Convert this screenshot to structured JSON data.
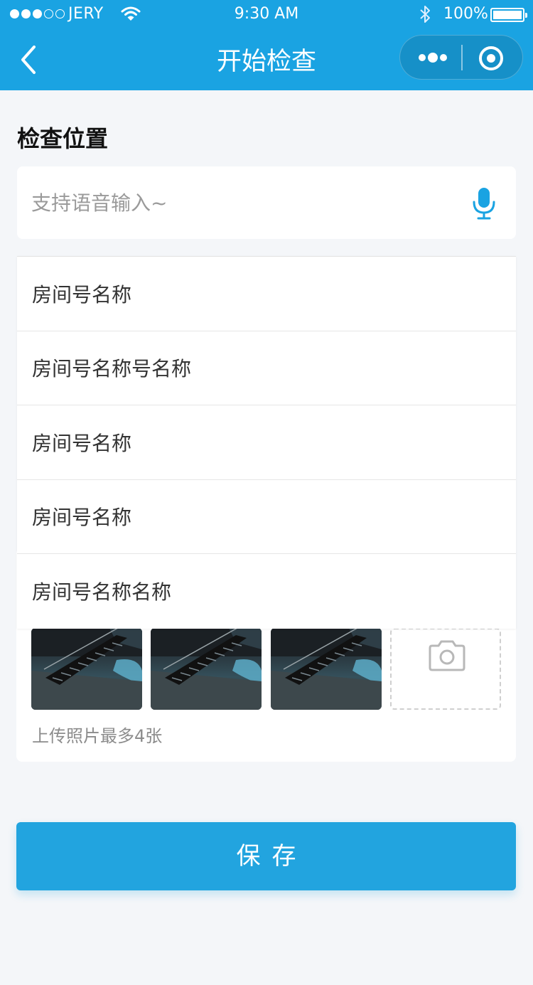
{
  "status_bar": {
    "carrier": "JERY",
    "time": "9:30 AM",
    "battery": "100%"
  },
  "nav": {
    "title": "开始检查"
  },
  "section": {
    "title": "检查位置"
  },
  "search": {
    "placeholder": "支持语音输入~",
    "value": ""
  },
  "dropdown": {
    "items": [
      "房间号名称",
      "房间号名称号名称",
      "房间号名称",
      "房间号名称",
      "房间号名称名称"
    ]
  },
  "photos": {
    "hint": "上传照片最多4张",
    "count": 3,
    "max": 4
  },
  "save_label": "保存",
  "colors": {
    "primary": "#1aa3e2",
    "button": "#22a4df"
  }
}
